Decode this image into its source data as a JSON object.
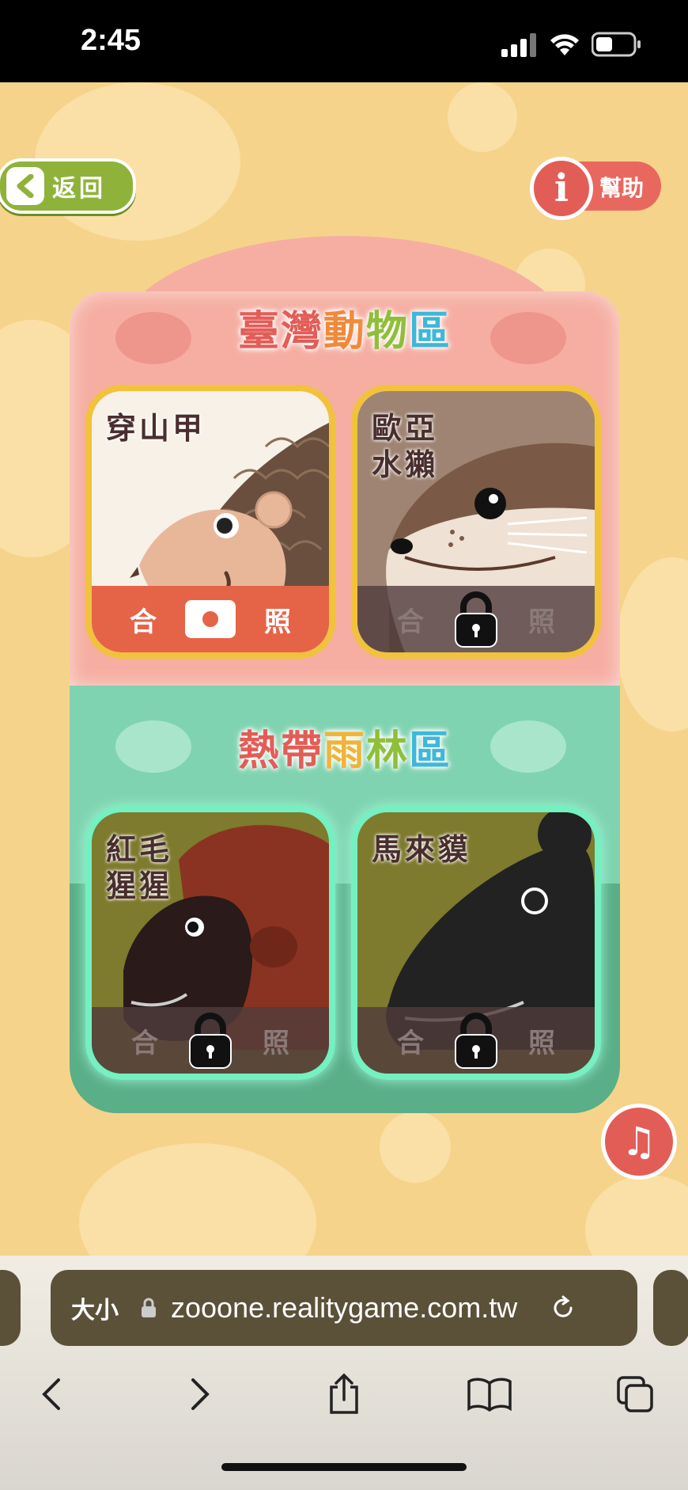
{
  "status": {
    "time": "2:45"
  },
  "nav": {
    "back_label": "返回",
    "help_label": "幫助",
    "help_icon_glyph": "i"
  },
  "zones": [
    {
      "title": "臺灣動物區",
      "title_colors": [
        "#e35d57",
        "#e35d57",
        "#f08a3a",
        "#8fbf3a",
        "#3fb7d8"
      ],
      "cards": [
        {
          "name": "穿山甲",
          "state": "unlocked",
          "bar_left": "合",
          "bar_right": "照"
        },
        {
          "name": "歐亞\n水獺",
          "state": "locked",
          "bar_left": "合",
          "bar_right": "照"
        }
      ]
    },
    {
      "title": "熱帶雨林區",
      "title_colors": [
        "#e35d57",
        "#e35d57",
        "#f0b33a",
        "#8fbf3a",
        "#3fb7d8"
      ],
      "cards": [
        {
          "name": "紅毛\n猩猩",
          "state": "locked",
          "bar_left": "合",
          "bar_right": "照"
        },
        {
          "name": "馬來貘",
          "state": "locked",
          "bar_left": "合",
          "bar_right": "照"
        }
      ]
    }
  ],
  "music_glyph": "♫",
  "browser": {
    "text_size_label": "大小",
    "url": "zooone.realitygame.com.tw"
  },
  "icons": [
    "chevron-left-icon",
    "info-icon",
    "camera-icon",
    "lock-icon",
    "music-note-icon",
    "padlock-icon",
    "reload-icon",
    "back-arrow-icon",
    "forward-arrow-icon",
    "share-icon",
    "bookmarks-icon",
    "tabs-icon"
  ]
}
